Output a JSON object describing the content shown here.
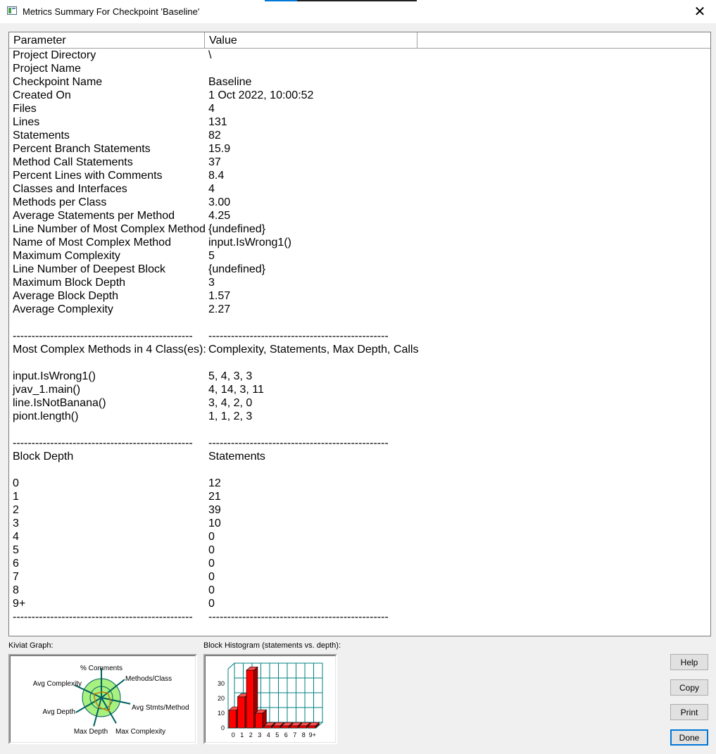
{
  "window": {
    "title": "Metrics Summary For Checkpoint 'Baseline'",
    "close_glyph": "✕"
  },
  "list": {
    "columns": [
      "Parameter",
      "Value"
    ],
    "rows": [
      [
        "Project Directory",
        "\\"
      ],
      [
        "Project Name",
        ""
      ],
      [
        "Checkpoint Name",
        "Baseline"
      ],
      [
        "Created On",
        "1 Oct 2022, 10:00:52"
      ],
      [
        "Files",
        "4"
      ],
      [
        "Lines",
        "131"
      ],
      [
        "Statements",
        "82"
      ],
      [
        "Percent Branch Statements",
        "15.9"
      ],
      [
        "Method Call Statements",
        "37"
      ],
      [
        "Percent Lines with Comments",
        "8.4"
      ],
      [
        "Classes and Interfaces",
        "4"
      ],
      [
        "Methods per Class",
        "3.00"
      ],
      [
        "Average Statements per Method",
        "4.25"
      ],
      [
        "Line Number of Most Complex Method",
        "{undefined}"
      ],
      [
        "Name of Most Complex Method",
        "input.IsWrong1()"
      ],
      [
        "Maximum Complexity",
        "5"
      ],
      [
        "Line Number of Deepest Block",
        "{undefined}"
      ],
      [
        "Maximum Block Depth",
        "3"
      ],
      [
        "Average Block Depth",
        "1.57"
      ],
      [
        "Average Complexity",
        "2.27"
      ],
      [
        "",
        ""
      ],
      [
        "------------------------------------------------",
        "------------------------------------------------"
      ],
      [
        "Most Complex Methods in 4 Class(es):",
        "Complexity, Statements, Max Depth, Calls"
      ],
      [
        "",
        ""
      ],
      [
        "input.IsWrong1()",
        "5, 4, 3, 3"
      ],
      [
        "jvav_1.main()",
        "4, 14, 3, 11"
      ],
      [
        "line.IsNotBanana()",
        "3, 4, 2, 0"
      ],
      [
        "piont.length()",
        "1, 1, 2, 3"
      ],
      [
        "",
        ""
      ],
      [
        "------------------------------------------------",
        "------------------------------------------------"
      ],
      [
        "Block Depth",
        "Statements"
      ],
      [
        "",
        ""
      ],
      [
        "0",
        "12"
      ],
      [
        "1",
        "21"
      ],
      [
        "2",
        "39"
      ],
      [
        "3",
        "10"
      ],
      [
        "4",
        "0"
      ],
      [
        "5",
        "0"
      ],
      [
        "6",
        "0"
      ],
      [
        "7",
        "0"
      ],
      [
        "8",
        "0"
      ],
      [
        "9+",
        "0"
      ],
      [
        "------------------------------------------------",
        "------------------------------------------------"
      ]
    ]
  },
  "kiviat": {
    "label": "Kiviat Graph:",
    "axes": [
      "% Comments",
      "Methods/Class",
      "Avg Stmts/Method",
      "Max Complexity",
      "Max Depth",
      "Avg Depth",
      "Avg Complexity"
    ],
    "ring_color": "#a8f080"
  },
  "histogram": {
    "label": "Block Histogram (statements vs. depth):",
    "categories": [
      "0",
      "1",
      "2",
      "3",
      "4",
      "5",
      "6",
      "7",
      "8",
      "9+"
    ],
    "values": [
      12,
      21,
      39,
      10,
      0,
      0,
      0,
      0,
      0,
      0
    ],
    "yticks": [
      "0",
      "10",
      "20",
      "30"
    ],
    "ylim": [
      0,
      40
    ],
    "bar_color": "#ff0000",
    "grid_color": "#008080"
  },
  "buttons": {
    "help": "Help",
    "copy": "Copy",
    "print": "Print",
    "done": "Done"
  }
}
